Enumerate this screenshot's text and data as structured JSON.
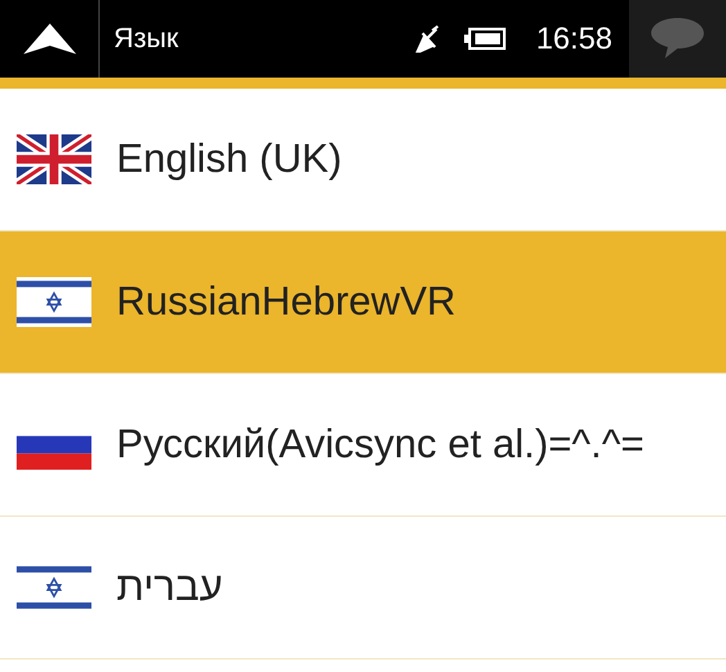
{
  "top_bar": {
    "title": "Язык",
    "time": "16:58"
  },
  "languages": [
    {
      "name": "English (UK)",
      "kind": "uk",
      "selected": false
    },
    {
      "name": "RussianHebrewVR",
      "kind": "il",
      "selected": true
    },
    {
      "name": "Русский(Avicsync et al.)=^.^=",
      "kind": "ru",
      "selected": false
    },
    {
      "name": "עברית",
      "kind": "il",
      "selected": false
    }
  ]
}
